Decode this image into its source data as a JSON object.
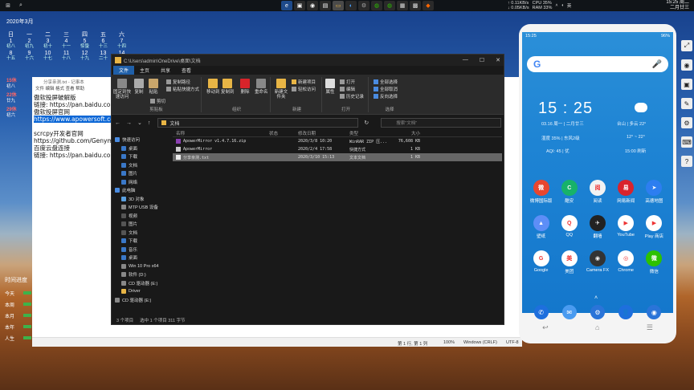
{
  "taskbar": {
    "tray_stats": [
      {
        "top": "↑ 0.11KB/s",
        "bottom": "↓ 0.05KB/s"
      },
      {
        "top": "CPU 35%",
        "bottom": "RAM 33%"
      }
    ],
    "lang": "英",
    "time": "15:25 周二",
    "date": "二月廿三"
  },
  "calendar": {
    "title": "2020年3月",
    "weekdays": [
      "日",
      "一",
      "二",
      "三",
      "四",
      "五",
      "六"
    ],
    "cells": [
      {
        "n": "1",
        "s": "初八"
      },
      {
        "n": "2",
        "s": "初九"
      },
      {
        "n": "3",
        "s": "初十"
      },
      {
        "n": "4",
        "s": "十一"
      },
      {
        "n": "5",
        "s": "惊蛰"
      },
      {
        "n": "6",
        "s": "十三"
      },
      {
        "n": "7",
        "s": "十四"
      },
      {
        "n": "8",
        "s": "十五"
      },
      {
        "n": "9",
        "s": "十六"
      },
      {
        "n": "10",
        "s": "十七"
      },
      {
        "n": "11",
        "s": "十八"
      },
      {
        "n": "12",
        "s": "十九"
      },
      {
        "n": "13",
        "s": "二十"
      },
      {
        "n": "14",
        "s": "廿一"
      }
    ]
  },
  "lunar_side": [
    "15休",
    "初八",
    "22休",
    "廿九",
    "29休",
    "初六"
  ],
  "notepad": {
    "title": "分享亲测.txt - 记事本",
    "menu": "文件  编辑  格式  查看  帮助",
    "lines": [
      "傲软投屏破解版",
      "链接: https://pan.baidu.com/s/1...",
      "傲软投屏官网",
      "https://www.apowersoft.com/...",
      "",
      "scrcpy开发者官网",
      "https://github.com/Genymobile/scrcpy",
      "百度云盘连接",
      "链接: https://pan.baidu.com/s/1..."
    ],
    "status": {
      "pos": "第 1 行, 第 1 列",
      "zoom": "100%",
      "eol": "Windows (CRLF)",
      "enc": "UTF-8"
    }
  },
  "progress": {
    "title": "时间进度",
    "rows": [
      "今天",
      "本周",
      "本月",
      "本年",
      "人生"
    ]
  },
  "explorer": {
    "title": "C:\\Users\\admin\\OneDrive\\桌面\\文档",
    "win_controls": [
      "—",
      "☐",
      "✕"
    ],
    "tabs": [
      "文件",
      "主页",
      "共享",
      "查看"
    ],
    "ribbon": {
      "clipboard": {
        "label": "剪贴板",
        "pin": "固定到快速访问",
        "copy": "复制",
        "paste": "粘贴",
        "cut": "剪切",
        "copy_path": "复制路径",
        "paste_shortcut": "粘贴快捷方式"
      },
      "organize": {
        "label": "组织",
        "move": "移动到",
        "copyto": "复制到",
        "delete": "删除",
        "rename": "重命名"
      },
      "new": {
        "label": "新建",
        "folder": "新建文件夹",
        "item": "新建项目",
        "easy": "轻松访问"
      },
      "open": {
        "label": "打开",
        "props": "属性",
        "open": "打开",
        "edit": "编辑",
        "history": "历史记录"
      },
      "select": {
        "label": "选择",
        "all": "全部选择",
        "none": "全部取消",
        "invert": "反向选择"
      }
    },
    "address": {
      "path": "文档",
      "search": "搜索\"文档\""
    },
    "nav": [
      "快速访问",
      "桌面",
      "下载",
      "文档",
      "图片",
      "网络",
      "此电脑",
      "3D 对象",
      "MTP USB 设备",
      "视频",
      "图片",
      "文档",
      "下载",
      "音乐",
      "桌面",
      "Win 10 Pro x64",
      "软件 (D:)",
      "CD 驱动器 (E:)",
      "Driver",
      "CD 驱动器 (E:)"
    ],
    "columns": [
      "名称",
      "状态",
      "修改日期",
      "类型",
      "大小"
    ],
    "files": [
      {
        "name": "ApowerMirror v1.4.7.16.zip",
        "status": "",
        "date": "2020/3/8 10:20",
        "type": "WinRAR ZIP 压...",
        "size": "76,608 KB"
      },
      {
        "name": "ApowerMirror",
        "status": "",
        "date": "2020/2/4 17:58",
        "type": "快捷方式",
        "size": "1 KB"
      },
      {
        "name": "分享亲测.txt",
        "status": "",
        "date": "2020/3/10 15:13",
        "type": "文本文档",
        "size": "1 KB"
      }
    ],
    "status": [
      "3 个项目",
      "选中 1 个项目  311 字节"
    ]
  },
  "phone": {
    "status_time": "15:25",
    "battery": "96%",
    "big_time": "15 : 25",
    "date": "03.16 周一 | 二月廿三",
    "weather_city": "台山 | 多云 22°",
    "humidity": "湿度 35% | 东风2级",
    "temp_range": "12° ~ 22°",
    "aqi": "AQI: 45 | 优",
    "refresh": "15:00 刷新",
    "apps": [
      {
        "label": "微博国际版",
        "color": "#e8462f",
        "glyph": "微"
      },
      {
        "label": "酷安",
        "color": "#17b26a",
        "glyph": "C"
      },
      {
        "label": "阅读",
        "color": "#f2f2f2",
        "glyph": "阅"
      },
      {
        "label": "网易新闻",
        "color": "#d9232d",
        "glyph": "易"
      },
      {
        "label": "高德地图",
        "color": "#2d7ef0",
        "glyph": "➤"
      },
      {
        "label": "壁纸",
        "color": "#5d8ef7",
        "glyph": "▲"
      },
      {
        "label": "QQ",
        "color": "#ffffff",
        "glyph": "Q"
      },
      {
        "label": "翻墙",
        "color": "#222222",
        "glyph": "✈"
      },
      {
        "label": "YouTube",
        "color": "#ffffff",
        "glyph": "▶"
      },
      {
        "label": "Play 商店",
        "color": "#ffffff",
        "glyph": "▶"
      },
      {
        "label": "Google",
        "color": "#ffffff",
        "glyph": "G"
      },
      {
        "label": "美团",
        "color": "#ffffff",
        "glyph": "美"
      },
      {
        "label": "Camera FX",
        "color": "#333333",
        "glyph": "◉"
      },
      {
        "label": "Chrome",
        "color": "#ffffff",
        "glyph": "◎"
      },
      {
        "label": "微信",
        "color": "#2dc100",
        "glyph": "微"
      }
    ],
    "nav": [
      "↩",
      "⌂",
      "☰"
    ]
  }
}
